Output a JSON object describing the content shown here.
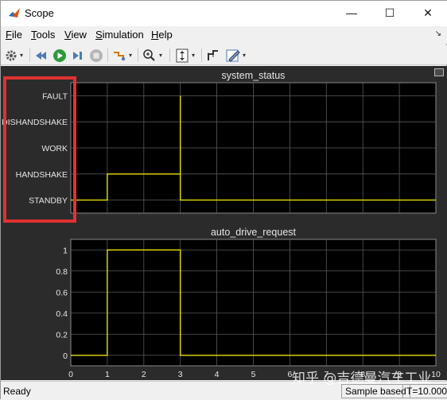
{
  "window": {
    "title": "Scope"
  },
  "window_controls": {
    "minimize": "—",
    "maximize": "☐",
    "close": "✕"
  },
  "menu": [
    {
      "label": "File",
      "accel": "F",
      "rest": "ile"
    },
    {
      "label": "Tools",
      "accel": "T",
      "rest": "ools"
    },
    {
      "label": "View",
      "accel": "V",
      "rest": "iew"
    },
    {
      "label": "Simulation",
      "accel": "S",
      "rest": "imulation"
    },
    {
      "label": "Help",
      "accel": "H",
      "rest": "elp"
    }
  ],
  "toolbar": {
    "icons": [
      "gear-icon",
      "rewind-icon",
      "run-icon",
      "step-forward-icon",
      "stop-icon",
      "highlight-signal-icon",
      "zoom-icon",
      "scale-axes-icon",
      "cursor-measure-icon",
      "style-icon"
    ]
  },
  "colors": {
    "plot_bg": "#000000",
    "figure_bg": "#2b2b2b",
    "trace": "#e8e000",
    "grid": "#5a5a5a",
    "axis_text": "#e6e6e6",
    "highlight": "#e03232"
  },
  "chart_data": [
    {
      "type": "line",
      "title": "system_status",
      "y_categories": [
        "STANDBY",
        "HANDSHAKE",
        "WORK",
        "DISHANDSHAKE",
        "FAULT"
      ],
      "y_tick_labels_visible": [
        "STANDBY",
        "HANDSHAKE",
        "WORK",
        "DISHANDSHAKE",
        "FAULT"
      ],
      "x": [
        0,
        1,
        1,
        3,
        3,
        3,
        10
      ],
      "y": [
        0,
        0,
        1,
        1,
        4,
        0,
        0
      ],
      "xlim": [
        0,
        10
      ],
      "ylim": [
        -0.5,
        4.5
      ],
      "grid": true
    },
    {
      "type": "line",
      "title": "auto_drive_request",
      "x": [
        0,
        1,
        1,
        3,
        3,
        10
      ],
      "y": [
        0,
        0,
        1,
        1,
        0,
        0
      ],
      "xlim": [
        0,
        10
      ],
      "ylim": [
        -0.1,
        1.1
      ],
      "yticks": [
        0,
        0.2,
        0.4,
        0.6,
        0.8,
        1
      ],
      "xticks": [
        0,
        1,
        2,
        3,
        4,
        5,
        6,
        7,
        8,
        9,
        10
      ],
      "grid": true
    }
  ],
  "statusbar": {
    "left": "Ready",
    "mode": "Sample based",
    "time": "T=10.000"
  },
  "watermark": "知乎 @吉德曼汽车工业"
}
